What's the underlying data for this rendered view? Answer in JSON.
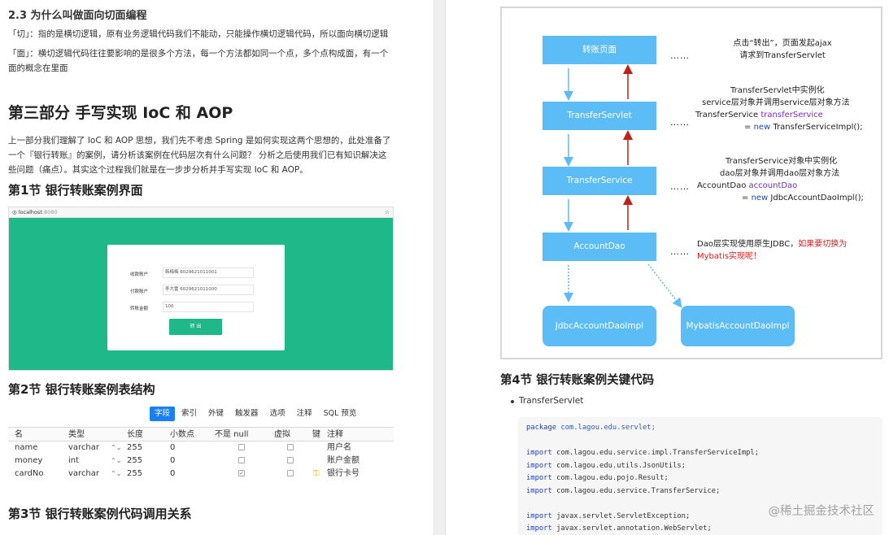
{
  "left": {
    "s23_title": "2.3 为什么叫做面向切面编程",
    "para_qie": "「切」：指的是横切逻辑，原有业务逻辑代码我们不能动，只能操作横切逻辑代码，所以面向横切逻辑",
    "para_mian": "「面」：横切逻辑代码往往要影响的是很多个方法，每一个方法都如同一个点，多个点构成面，有一个面的概念在里面",
    "part3_title": "第三部分 手写实现 IoC 和 AOP",
    "intro": "上一部分我们理解了 IoC 和 AOP 思想，我们先不考虑 Spring 是如何实现这两个思想的，此处准备了一个『银行转账』的案例，请分析该案例在代码层次有什么问题？ 分析之后使用我们已有知识解决这些问题（痛点）。其实这个过程我们就是在一步步分析并手写实现 IoC 和 AOP。",
    "sec1_title": "第1节 银行转账案例界面",
    "browser": {
      "url_host": "localhost",
      "url_port": ":8080",
      "star": "☆",
      "form": [
        {
          "label": "收款账户",
          "value": "韩梅梅 6029621011001"
        },
        {
          "label": "付款账户",
          "value": "李大雷 6029621011000"
        },
        {
          "label": "转账金额",
          "value": "100"
        }
      ],
      "submit": "转 出"
    },
    "sec2_title": "第2节 银行转账案例表结构",
    "db_tabs": [
      "字段",
      "索引",
      "外键",
      "触发器",
      "选项",
      "注释",
      "SQL 预览"
    ],
    "db_headers": [
      "名",
      "类型",
      "长度",
      "小数点",
      "不是 null",
      "虚拟",
      "键",
      "注释"
    ],
    "db_rows": [
      {
        "name": "name",
        "type": "varchar",
        "len": "255",
        "dec": "0",
        "notnull": false,
        "virtual": false,
        "key": false,
        "comment": "用户名"
      },
      {
        "name": "money",
        "type": "int",
        "len": "255",
        "dec": "0",
        "notnull": false,
        "virtual": false,
        "key": false,
        "comment": "账户金额"
      },
      {
        "name": "cardNo",
        "type": "varchar",
        "len": "255",
        "dec": "0",
        "notnull": true,
        "virtual": false,
        "key": true,
        "comment": "银行卡号"
      }
    ],
    "sec3_title": "第3节 银行转账案例代码调用关系"
  },
  "diagram": {
    "boxes": [
      "转账页面",
      "TransferServlet",
      "TransferService",
      "AccountDao",
      "JdbcAccountDaoImpl",
      "MybatisAccountDaoImpl"
    ],
    "dots": "……",
    "note1": [
      "点击“转出”，页面发起ajax",
      "请求到TransferServlet"
    ],
    "note2": {
      "l1": "TransferServlet中实例化",
      "l2": "service层对象并调用service层对象方法",
      "l3a": "TransferService ",
      "l3b": "transferService",
      "l4a": "= ",
      "l4b": "new",
      "l4c": " TransferServiceImpl();"
    },
    "note3": {
      "l1": "TransferService对象中实例化",
      "l2": "dao层对象并调用dao层对象方法",
      "l3a": "AccountDao ",
      "l3b": "accountDao",
      "l4a": "= ",
      "l4b": "new",
      "l4c": " JdbcAccountDaoImpl();"
    },
    "note4": {
      "a": "Dao层实现使用原生JDBC，",
      "b": "如果要切换为",
      "c": "Mybatis实现呢！"
    }
  },
  "right": {
    "sec4_title": "第4节 银行转账案例关键代码",
    "bullet": "TransferServlet",
    "code": [
      {
        "kw": "package",
        "rest": " com.lagou.edu.servlet;",
        "pkg": true
      },
      {
        "kw": "",
        "rest": ""
      },
      {
        "kw": "import",
        "rest": " com.lagou.edu.service.impl.TransferServiceImpl;"
      },
      {
        "kw": "import",
        "rest": " com.lagou.edu.utils.JsonUtils;"
      },
      {
        "kw": "import",
        "rest": " com.lagou.edu.pojo.Result;"
      },
      {
        "kw": "import",
        "rest": " com.lagou.edu.service.TransferService;"
      },
      {
        "kw": "",
        "rest": ""
      },
      {
        "kw": "import",
        "rest": " javax.servlet.ServletException;"
      },
      {
        "kw": "import",
        "rest": " javax.servlet.annotation.WebServlet;"
      }
    ],
    "watermark": "@稀土掘金技术社区"
  }
}
